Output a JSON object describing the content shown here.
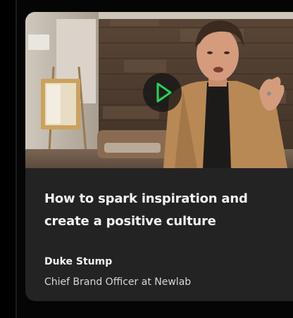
{
  "card": {
    "title": "How to spark inspiration and create a positive culture",
    "speaker_name": "Duke Stump",
    "speaker_role": "Chief Brand Officer at Newlab"
  },
  "video": {
    "play_icon": "play-icon",
    "accent_color": "#22d45a"
  }
}
